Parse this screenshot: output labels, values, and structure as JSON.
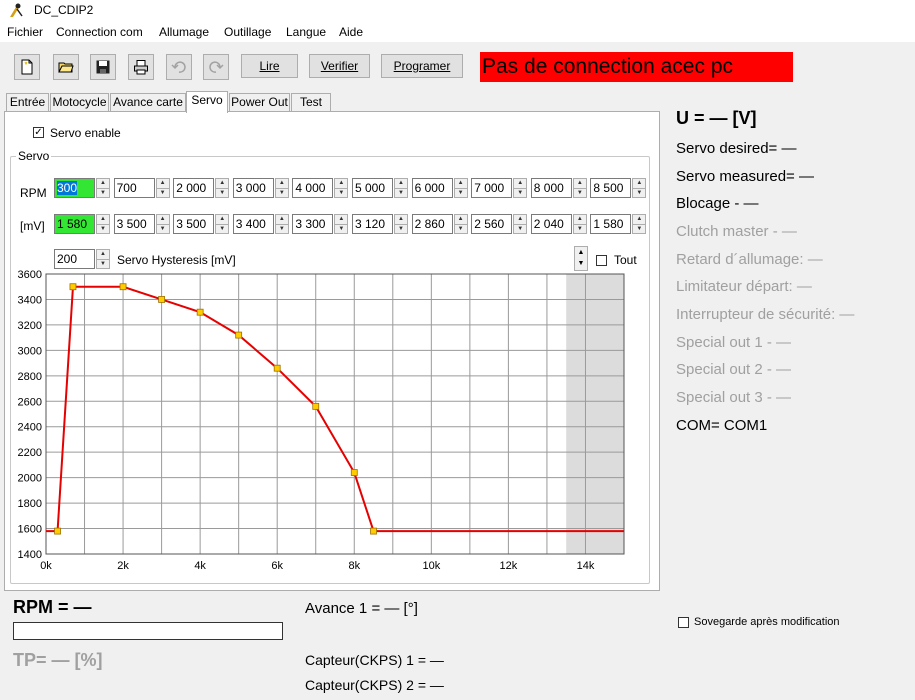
{
  "window": {
    "title": "DC_CDIP2"
  },
  "menu": [
    "Fichier",
    "Connection com",
    "Allumage",
    "Outillage",
    "Langue",
    "Aide"
  ],
  "toolbar": {
    "icons": [
      "new-file-icon",
      "open-folder-icon",
      "save-icon",
      "print-icon",
      "undo-icon",
      "redo-icon"
    ],
    "lire": "Lire",
    "verifier": "Verifier",
    "programmer": "Programer"
  },
  "status": {
    "connection": "Pas de connection acec pc",
    "color": "#ff0000"
  },
  "tabs": [
    "Entrée",
    "Motocycle",
    "Avance carte",
    "Servo",
    "Power Out",
    "Test"
  ],
  "active_tab": "Servo",
  "servo": {
    "enable_label": "Servo enable",
    "enabled": true,
    "group_label": "Servo",
    "rpm_label": "RPM",
    "mv_label": "[mV]",
    "rpm_values": [
      "300",
      "700",
      "2 000",
      "3 000",
      "4 000",
      "5 000",
      "6 000",
      "7 000",
      "8 000",
      "8 500"
    ],
    "mv_values": [
      "1 580",
      "3 500",
      "3 500",
      "3 400",
      "3 300",
      "3 120",
      "2 860",
      "2 560",
      "2 040",
      "1 580"
    ],
    "hysteresis_value": "200",
    "hysteresis_label": "Servo Hysteresis [mV]",
    "tout_label": "Tout",
    "tout_checked": false
  },
  "chart_data": {
    "type": "line",
    "x": [
      0,
      300,
      700,
      2000,
      3000,
      4000,
      5000,
      6000,
      7000,
      8000,
      8500,
      15000
    ],
    "y": [
      1580,
      1580,
      3500,
      3500,
      3400,
      3300,
      3120,
      2860,
      2560,
      2040,
      1580,
      1580
    ],
    "markers_x": [
      300,
      700,
      2000,
      3000,
      4000,
      5000,
      6000,
      7000,
      8000,
      8500
    ],
    "markers_y": [
      1580,
      3500,
      3500,
      3400,
      3300,
      3120,
      2860,
      2560,
      2040,
      1580
    ],
    "xlim": [
      0,
      15000
    ],
    "ylim": [
      1400,
      3600
    ],
    "xticks": [
      0,
      2000,
      4000,
      6000,
      8000,
      10000,
      12000,
      14000
    ],
    "xtick_labels": [
      "0k",
      "2k",
      "4k",
      "6k",
      "8k",
      "10k",
      "12k",
      "14k"
    ],
    "yticks": [
      1400,
      1600,
      1800,
      2000,
      2200,
      2400,
      2600,
      2800,
      3000,
      3200,
      3400,
      3600
    ],
    "ytick_labels": [
      "1400",
      "1600",
      "1800",
      "2000",
      "2200",
      "2400",
      "2600",
      "2800",
      "3000",
      "3200",
      "3400",
      "3600"
    ],
    "shaded_from_x": 13500,
    "grid": true,
    "line_color": "#e60000",
    "marker_color": "#ffcc00"
  },
  "info": {
    "voltage": "U = — [V]",
    "servo_desired": "Servo desired= —",
    "servo_measured": "Servo measured= —",
    "blocage": "Blocage - —",
    "clutch_master": "Clutch master - —",
    "retard": "Retard d´allumage: —",
    "limitateur": "Limitateur départ: —",
    "interrupteur": "Interrupteur de sécurité: —",
    "special1": "Special out 1 - —",
    "special2": "Special out 2 - —",
    "special3": "Special out 3 - —",
    "com": "COM= COM1"
  },
  "bottom": {
    "rpm": "RPM = —",
    "rpm_progress": 0,
    "tp": "TP= — [%]",
    "avance": "Avance 1 = — [°]",
    "ckps1": "Capteur(CKPS) 1 = —",
    "ckps2": "Capteur(CKPS) 2 = —",
    "sauve_label": "Sovegarde après modification",
    "sauve_checked": false
  }
}
